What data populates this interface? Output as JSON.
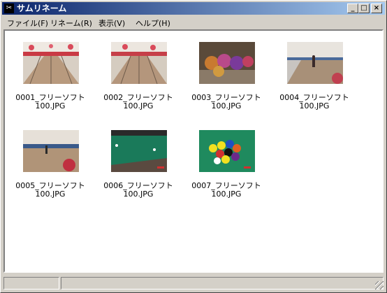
{
  "window": {
    "title": "サムリネーム",
    "minimize": "_",
    "maximize": "□",
    "close": "×"
  },
  "menu": [
    "ファイル(F)",
    "リネーム(R)",
    "表示(V)",
    "ヘルプ(H)"
  ],
  "files": [
    {
      "line1": "0001_フリーソフト",
      "line2": "100.JPG",
      "scene": "bowling-lanes-red"
    },
    {
      "line1": "0002_フリーソフト",
      "line2": "100.JPG",
      "scene": "bowling-lanes-red"
    },
    {
      "line1": "0003_フリーソフト",
      "line2": "100.JPG",
      "scene": "bowling-balls"
    },
    {
      "line1": "0004_フリーソフト",
      "line2": "100.JPG",
      "scene": "bowling-alley-person"
    },
    {
      "line1": "0005_フリーソフト",
      "line2": "100.JPG",
      "scene": "bowling-alley-wide"
    },
    {
      "line1": "0006_フリーソフト",
      "line2": "100.JPG",
      "scene": "pool-table"
    },
    {
      "line1": "0007_フリーソフト",
      "line2": "100.JPG",
      "scene": "pool-balls-rack"
    }
  ]
}
